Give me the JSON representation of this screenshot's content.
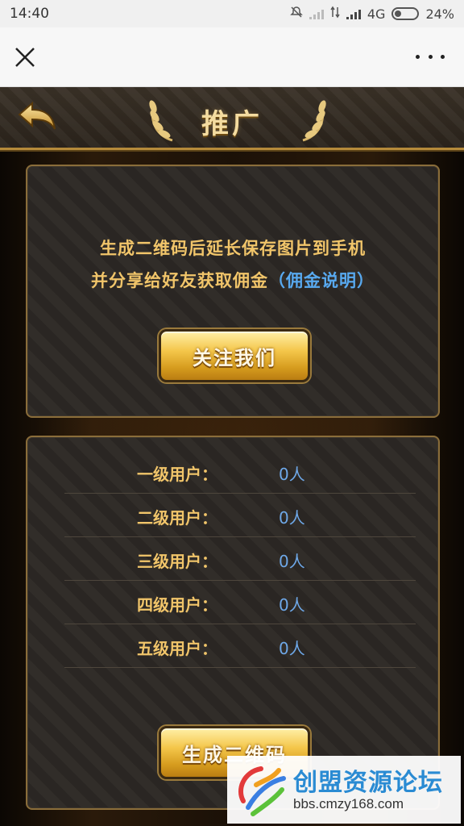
{
  "status_bar": {
    "time": "14:40",
    "network": "4G",
    "battery": "24%"
  },
  "title_bar": {
    "close_icon": "close-icon",
    "more_icon": "more-icon"
  },
  "game_header": {
    "title": "推广",
    "back_icon": "back-arrow-icon"
  },
  "promo_panel": {
    "line1": "生成二维码后延长保存图片到手机",
    "line2_prefix": "并分享给好友获取佣金",
    "line2_link": "（佣金说明）",
    "follow_button": "关注我们"
  },
  "users_panel": {
    "rows": [
      {
        "label": "一级用户：",
        "count": "0人"
      },
      {
        "label": "二级用户：",
        "count": "0人"
      },
      {
        "label": "三级用户：",
        "count": "0人"
      },
      {
        "label": "四级用户：",
        "count": "0人"
      },
      {
        "label": "五级用户：",
        "count": "0人"
      }
    ],
    "generate_button": "生成二维码"
  },
  "watermark": {
    "title": "创盟资源论坛",
    "subtitle": "bbs.cmzy168.com"
  },
  "colors": {
    "gold_text": "#f1c56a",
    "blue_text": "#6ea8e8",
    "link": "#58a9ef"
  }
}
